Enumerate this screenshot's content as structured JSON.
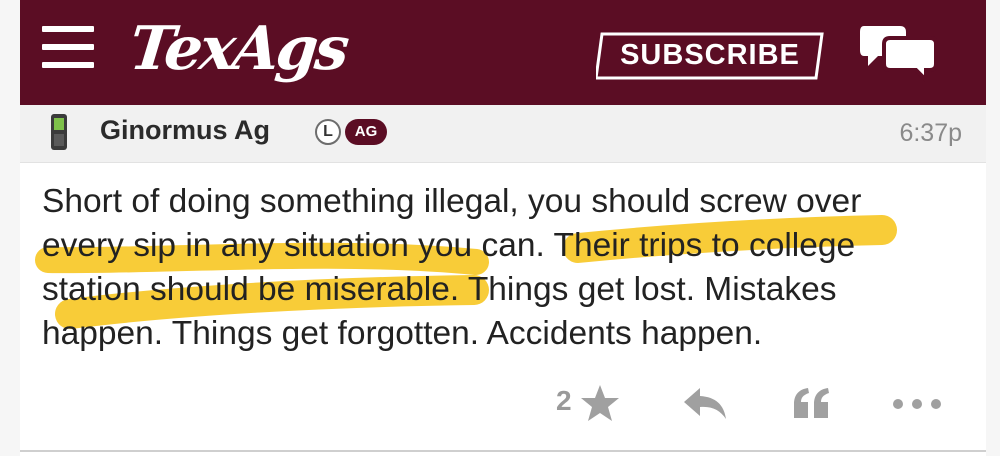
{
  "header": {
    "logo_text": "TexAgs",
    "subscribe_label": "SUBSCRIBE",
    "icons": {
      "menu": "hamburger-menu-icon",
      "chat": "chat-bubbles-icon"
    }
  },
  "post": {
    "author": "Ginormus Ag",
    "badges": {
      "l": "L",
      "ag": "AG"
    },
    "timestamp": "6:37p",
    "body_lines": [
      "Short of doing something illegal, you should screw over",
      "every sip in any situation you can. Their trips to college",
      "station should be miserable. Things get lost. Mistakes",
      "happen. Things get forgotten. Accidents happen."
    ],
    "highlight_color": "#f7c722"
  },
  "actions": {
    "star_count": "2",
    "icons": [
      "star-icon",
      "reply-icon",
      "quote-icon",
      "more-icon"
    ]
  },
  "colors": {
    "brand_maroon": "#5b0d24",
    "header_gray": "#f1f1f1",
    "icon_gray": "#9a9a9a"
  }
}
